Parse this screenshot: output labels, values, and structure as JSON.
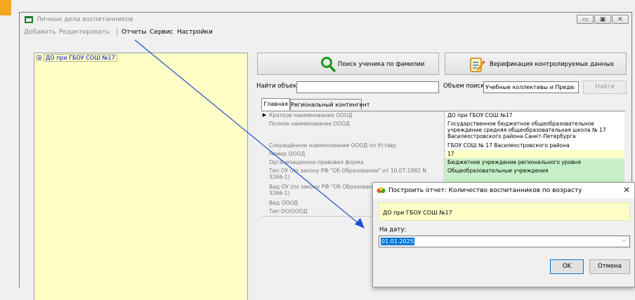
{
  "window": {
    "title": "Личные дела воспитанников",
    "controls": [
      "minimize",
      "maximize",
      "close"
    ]
  },
  "menu": {
    "add": "Добавить",
    "edit": "Редактировать",
    "reports": "Отчеты",
    "service": "Сервис",
    "settings": "Настройки"
  },
  "tree": {
    "root": {
      "expander": "+",
      "label": "ДО при ГБОУ СОШ №17"
    }
  },
  "toolbar": {
    "search_student": "Поиск ученика по фамилии",
    "verify": "Верификация контролируемых данных"
  },
  "search": {
    "find_label": "Найти объект",
    "find_value": "",
    "scope_label": "Объем поиска",
    "scope_value": "Учебные коллективы и Преде",
    "find_button": "Найти"
  },
  "tabs": [
    "Главная",
    "Региональный контингент"
  ],
  "properties": [
    {
      "name": "Краткое наименование ОООД",
      "value": "ДО при ГБОУ СОШ №17",
      "highlight": "#ffffff"
    },
    {
      "name": "Полное наименование ОООД",
      "value": "Государственное бюджетное общеобразовательное учреждение средняя общеобразовательная школа № 17 Василеостровского района Санкт-Петербурга",
      "highlight": "#ffffff"
    },
    {
      "name": "Сокращённое наименование ОООД по Уставу",
      "value": "ГБОУ СОШ № 17 Василеостровского района",
      "highlight": "#ffffff"
    },
    {
      "name": "Номер ОООД",
      "value": "17",
      "highlight": "#ffffc8"
    },
    {
      "name": "Организационно-правовая форма",
      "value": "Бюджетное учреждение регионального уровня",
      "highlight": "#c8f0c8"
    },
    {
      "name": "Тип ОУ (по закону РФ \"Об Образовании\" от 10.07.1992 N 3266-1)",
      "value": "Общеобразовательные учреждения",
      "highlight": "#c8f0c8"
    },
    {
      "name": "Вид ОУ (по закону РФ \"Об Образовании\" от 10.07.1992 N 3266-1)",
      "value": "",
      "highlight": "#ffffff"
    },
    {
      "name": "Вид ОООД",
      "value": "",
      "highlight": "#ffffff"
    },
    {
      "name": "Тип ОО/ОООД",
      "value": "",
      "highlight": "#ffffff"
    }
  ],
  "dialog": {
    "title": "Построить отчет: Количество воспитанников по возрасту",
    "org": "ДО при ГБОУ СОШ №17",
    "date_label": "На дату:",
    "date_value": "01.01.2025",
    "ok": "OK",
    "cancel": "Отмена",
    "close": "✕"
  },
  "colors": {
    "accent": "#f5a623",
    "tree_bg": "#ffffc8",
    "link": "#0000cc",
    "annotation_line": "#1f4fd1",
    "search_icon": "#1a9a1a"
  }
}
